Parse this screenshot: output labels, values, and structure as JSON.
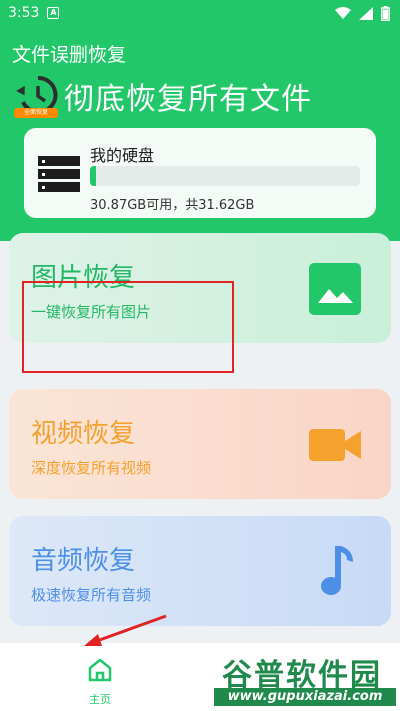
{
  "status": {
    "time": "3:53"
  },
  "header": {
    "app_title": "文件误删恢复",
    "hero_title": "彻底恢复所有文件",
    "badge": "全面恢复"
  },
  "disk": {
    "name": "我的硬盘",
    "usage": "30.87GB可用，共31.62GB",
    "used_fraction": 0.024
  },
  "cards": [
    {
      "title": "图片恢复",
      "subtitle": "一键恢复所有图片",
      "icon": "image-icon"
    },
    {
      "title": "视频恢复",
      "subtitle": "深度恢复所有视频",
      "icon": "video-camera-icon"
    },
    {
      "title": "音频恢复",
      "subtitle": "极速恢复所有音频",
      "icon": "music-note-icon"
    }
  ],
  "nav": {
    "home_label": "主页"
  },
  "watermark": {
    "main": "谷普软件园",
    "url": "www.gupuxiazai.com"
  },
  "colors": {
    "brand": "#22c76a",
    "photo": "#22b865",
    "video": "#f5a12d",
    "audio": "#4d8fe6",
    "annotation": "#e02424"
  }
}
